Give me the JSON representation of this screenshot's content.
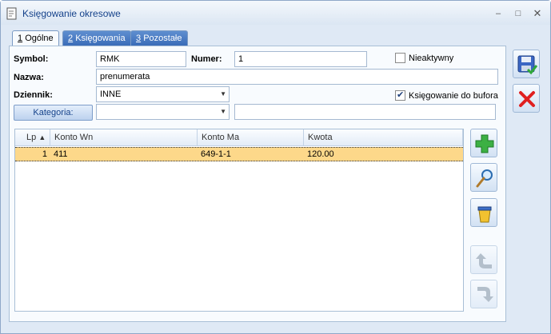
{
  "window": {
    "title": "Księgowanie okresowe",
    "controls": {
      "minimize": "–",
      "maximize": "□",
      "close": "✕"
    }
  },
  "tabs": [
    {
      "key": "1",
      "label": "Ogólne",
      "active": true
    },
    {
      "key": "2",
      "label": "Księgowania",
      "active": false
    },
    {
      "key": "3",
      "label": "Pozostałe",
      "active": false
    }
  ],
  "form": {
    "symbol_label": "Symbol:",
    "symbol_value": "RMK",
    "numer_label": "Numer:",
    "numer_value": "1",
    "nieaktywny_label": "Nieaktywny",
    "nieaktywny_checked": false,
    "nazwa_label": "Nazwa:",
    "nazwa_value": "prenumerata",
    "dziennik_label": "Dziennik:",
    "dziennik_value": "INNE",
    "bufor_label": "Księgowanie do bufora",
    "bufor_checked": true,
    "kategoria_button": "Kategoria:",
    "kategoria_value": "",
    "kategoria_desc": ""
  },
  "grid": {
    "columns": [
      "Lp",
      "Konto Wn",
      "Konto Ma",
      "Kwota"
    ],
    "sort_indicator": "▲",
    "rows": [
      {
        "lp": "1",
        "konto_wn": "411",
        "konto_ma": "649-1-1",
        "kwota": "120.00"
      }
    ]
  },
  "icons": {
    "save": "floppy-save-icon",
    "cancel": "red-x-icon",
    "add": "green-plus-icon",
    "edit": "magnifier-icon",
    "delete": "trash-bin-icon",
    "up": "arrow-up-icon",
    "down": "arrow-down-icon"
  },
  "colors": {
    "selected_row": "#fdd88a",
    "tab_active_bg": "#f8fbfe",
    "tab_inactive_bg": "#4a7cc4",
    "title_text": "#15428b"
  }
}
